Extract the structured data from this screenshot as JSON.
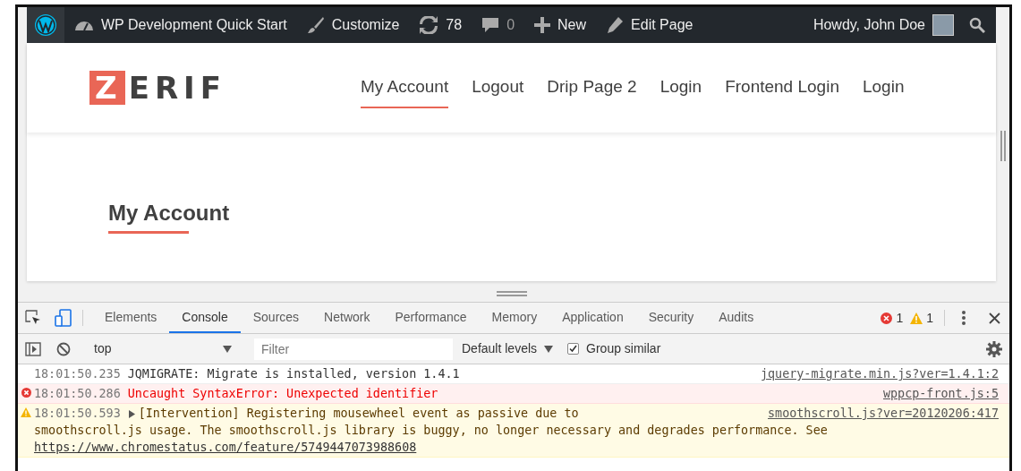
{
  "admin_bar": {
    "items": [
      {
        "kind": "site",
        "label": "WP Development Quick Start"
      },
      {
        "kind": "customize",
        "label": "Customize"
      },
      {
        "kind": "updates",
        "label": "78"
      },
      {
        "kind": "comments",
        "label": "0"
      },
      {
        "kind": "new",
        "label": "New"
      },
      {
        "kind": "edit",
        "label": "Edit Page"
      }
    ],
    "account": "Howdy, John Doe"
  },
  "site_header": {
    "logo": {
      "mark": "Z",
      "text": "ERIF"
    },
    "menu": [
      {
        "label": "My Account",
        "selected": true
      },
      {
        "label": "Logout",
        "selected": false
      },
      {
        "label": "Drip Page 2",
        "selected": false
      },
      {
        "label": "Login",
        "selected": false
      },
      {
        "label": "Frontend Login",
        "selected": false
      },
      {
        "label": "Login",
        "selected": false
      }
    ]
  },
  "page_title": "My Account",
  "devtools": {
    "tabs": [
      {
        "label": "Elements",
        "selected": false
      },
      {
        "label": "Console",
        "selected": true
      },
      {
        "label": "Sources",
        "selected": false
      },
      {
        "label": "Network",
        "selected": false
      },
      {
        "label": "Performance",
        "selected": false
      },
      {
        "label": "Memory",
        "selected": false
      },
      {
        "label": "Application",
        "selected": false
      },
      {
        "label": "Security",
        "selected": false
      },
      {
        "label": "Audits",
        "selected": false
      }
    ],
    "error_count": "1",
    "warning_count": "1",
    "toolbar": {
      "context": "top",
      "filter": {
        "placeholder": "Filter"
      },
      "levels": "Default levels",
      "group_similar": {
        "label": "Group similar",
        "checked": true
      }
    },
    "messages": [
      {
        "kind": "log",
        "time": "18:01:50.235",
        "text": "JQMIGRATE: Migrate is installed, version 1.4.1",
        "source": "jquery-migrate.min.js?ver=1.4.1:2"
      },
      {
        "kind": "error",
        "time": "18:01:50.286",
        "text": "Uncaught SyntaxError: Unexpected identifier",
        "source": "wppcp-front.js:5"
      },
      {
        "kind": "warning",
        "time": "18:01:50.593",
        "expanded": false,
        "text": "[Intervention] Registering mousewheel event as passive due to",
        "source": "smoothscroll.js?ver=20120206:417",
        "details": "smoothscroll.js usage. The smoothscroll.js library is buggy, no longer necessary and degrades performance. See",
        "link": "https://www.chromestatus.com/feature/5749447073988608"
      }
    ]
  }
}
